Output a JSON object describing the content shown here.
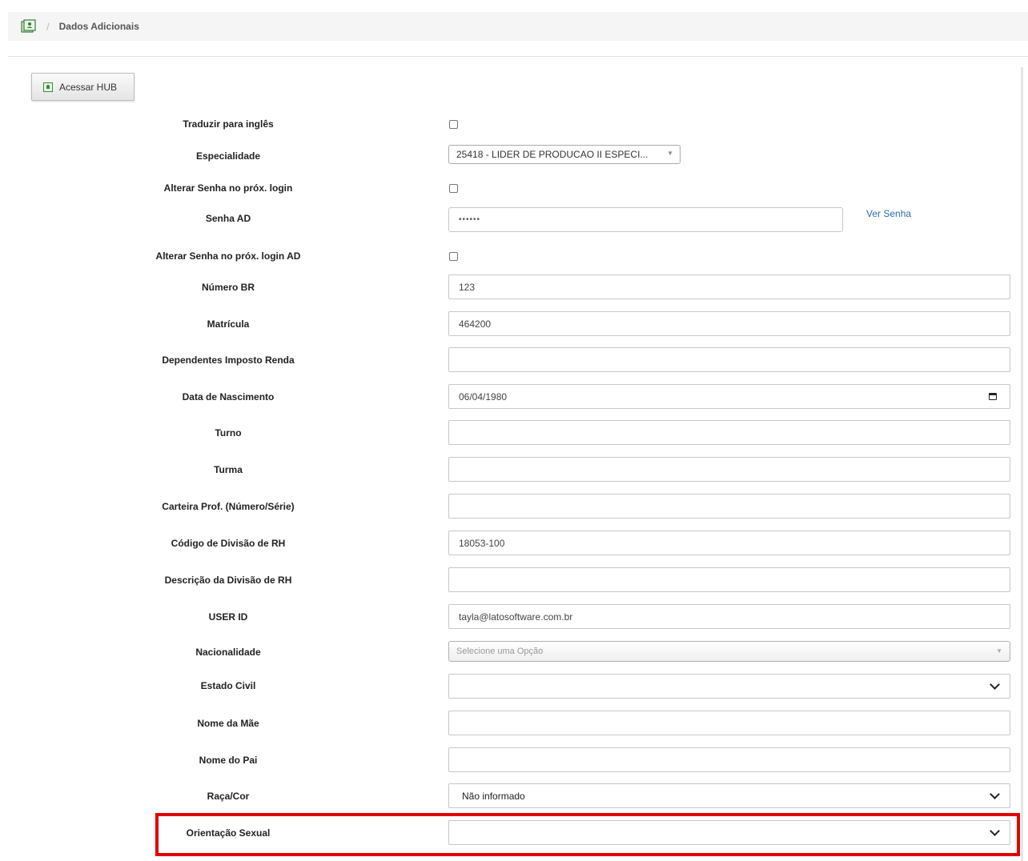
{
  "breadcrumb": {
    "home_icon": "book-icon",
    "separator": "/",
    "current": "Dados Adicionais"
  },
  "hub_button": {
    "label": "Acessar HUB",
    "icon": "hub-icon"
  },
  "fields": {
    "traduzir": {
      "label": "Traduzir para inglês",
      "checked": false
    },
    "especialidade": {
      "label": "Especialidade",
      "value": "25418 - LIDER DE PRODUCAO II ESPECI..."
    },
    "alterar_senha": {
      "label": "Alterar Senha no próx. login",
      "checked": false
    },
    "senha_ad": {
      "label": "Senha AD",
      "value": "••••••",
      "link": "Ver Senha"
    },
    "alterar_senha_ad": {
      "label": "Alterar Senha no próx. login AD",
      "checked": false
    },
    "numero_br": {
      "label": "Número BR",
      "value": "123"
    },
    "matricula": {
      "label": "Matrícula",
      "value": "464200"
    },
    "dependentes": {
      "label": "Dependentes Imposto Renda",
      "value": ""
    },
    "data_nascimento": {
      "label": "Data de Nascimento",
      "value": "06/04/1980"
    },
    "turno": {
      "label": "Turno",
      "value": ""
    },
    "turma": {
      "label": "Turma",
      "value": ""
    },
    "carteira": {
      "label": "Carteira Prof. (Número/Série)",
      "value": ""
    },
    "codigo_divisao": {
      "label": "Código de Divisão de RH",
      "value": "18053-100"
    },
    "descricao_divisao": {
      "label": "Descrição da Divisão de RH",
      "value": ""
    },
    "user_id": {
      "label": "USER ID",
      "value": "tayla@latosoftware.com.br"
    },
    "nacionalidade": {
      "label": "Nacionalidade",
      "placeholder": "Selecione uma Opção"
    },
    "estado_civil": {
      "label": "Estado Civil",
      "value": ""
    },
    "nome_mae": {
      "label": "Nome da Mãe",
      "value": ""
    },
    "nome_pai": {
      "label": "Nome do Pai",
      "value": ""
    },
    "raca_cor": {
      "label": "Raça/Cor",
      "value": "Não informado"
    },
    "orientacao_sexual": {
      "label": "Orientação Sexual",
      "value": ""
    }
  },
  "highlight_color": "#e00000",
  "link_color": "#2a6db3"
}
